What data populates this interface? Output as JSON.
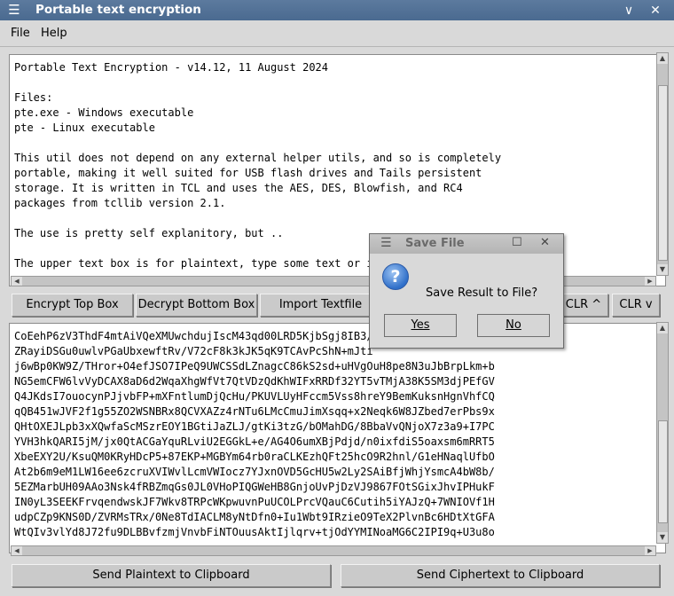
{
  "window": {
    "title": "Portable text encryption",
    "menu_icon": "☰",
    "minimize": "∨",
    "close": "✕"
  },
  "menubar": {
    "file": "File",
    "help": "Help"
  },
  "top_box": {
    "lines": [
      "Portable Text Encryption - v14.12, 11 August 2024",
      "",
      "Files:",
      "pte.exe - Windows executable",
      "pte - Linux executable",
      "",
      "This util does not depend on any external helper utils, and so is completely",
      "portable, making it well suited for USB flash drives and Tails persistent",
      "storage. It is written in TCL and uses the AES, DES, Blowfish, and RC4",
      "packages from tcllib version 2.1.",
      "",
      "The use is pretty self explanitory, but ..",
      "",
      "The upper text box is for plaintext, type some text or im"
    ]
  },
  "buttons": {
    "encrypt": "Encrypt Top Box",
    "decrypt": "Decrypt Bottom Box",
    "import": "Import Textfile",
    "clr_up": "CLR ^",
    "clr_down": "CLR v",
    "send_plain": "Send Plaintext to Clipboard",
    "send_cipher": "Send Ciphertext to Clipboard"
  },
  "bottom_box": {
    "lines": [
      "CoEehP6zV3ThdF4mtAiVQeXMUwchdujIscM43qd00LRD5KjbSgj8IB3/9",
      "ZRayiDSGu0uwlvPGaUbxewftRv/V72cF8k3kJK5qK9TCAvPcShN+mJti",
      "j6wBp0KW9Z/THror+O4efJSO7IPeQ9UWCSSdLZnagcC86kS2sd+uHVgOuH8pe8N3uJbBrpLkm+b",
      "NG5emCFW6lvVyDCAX8aD6d2WqaXhgWfVt7QtVDzQdKhWIFxRRDf32YT5vTMjA38K5SM3djPEfGV",
      "Q4JKdsI7ouocynPJjvbFP+mXFntlumDjQcHu/PKUVLUyHFccm5Vss8hreY9BemKuksnHgnVhfCQ",
      "qQB451wJVF2f1g55ZO2WSNBRx8QCVXAZz4rNTu6LMcCmuJimXsqq+x2Neqk6W8JZbed7erPbs9x",
      "QHtOXEJLpb3xXQwfaScMSzrEOY1BGtiJaZLJ/gtKi3tzG/bOMahDG/8BbaVvQNjoX7z3a9+I7PC",
      "YVH3hkQARI5jM/jx0QtACGaYquRLviU2EGGkL+e/AG4O6umXBjPdjd/n0ixfdiS5oaxsm6mRRT5",
      "XbeEXY2U/KsuQM0KRyHDcP5+87EKP+MGBYm64rb0raCLKEzhQFt25hcO9R2hnl/G1eHNaqlUfbO",
      "At2b6m9eM1LW16ee6zcruXVIWvlLcmVWIocz7YJxnOVD5GcHU5w2Ly2SAiBfjWhjYsmcA4bW8b/",
      "5EZMarbUH09AAo3Nsk4fRBZmqGs0JL0VHoPIQGWeHB8GnjoUvPjDzVJ9867FOtSGixJhvIPHukF",
      "IN0yL3SEEKFrvqendwskJF7Wkv8TRPcWKpwuvnPuUCOLPrcVQauC6Cutih5iYAJzQ+7WNIOVf1H",
      "udpCZp9KNS0D/ZVRMsTRx/0Ne8TdIACLM8yNtDfn0+Iu1Wbt9IRzieO9TeX2PlvnBc6HDtXtGFA",
      "WtQIv3vlYd8J72fu9DLBBvfzmjVnvbFiNTOuusAktIjlqrv+tjOdYYMINoaMG6C2IPI9q+U3u8o"
    ]
  },
  "dialog": {
    "title": "Save File",
    "message": "Save Result to File?",
    "yes": "Yes",
    "no": "No",
    "icon_glyph": "?"
  }
}
